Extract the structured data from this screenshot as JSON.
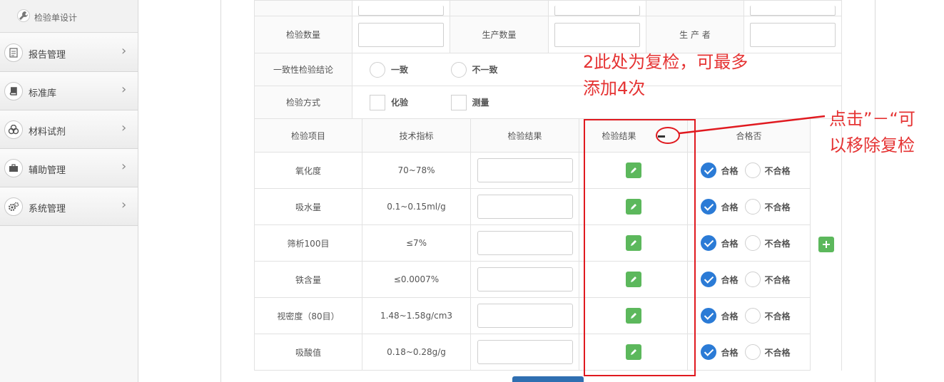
{
  "sidebar": {
    "sub_item": "检验单设计",
    "items": [
      {
        "label": "报告管理",
        "icon": "document-icon"
      },
      {
        "label": "标准库",
        "icon": "book-icon"
      },
      {
        "label": "材料试剂",
        "icon": "flask-icon"
      },
      {
        "label": "辅助管理",
        "icon": "briefcase-icon"
      },
      {
        "label": "系统管理",
        "icon": "gears-icon"
      }
    ]
  },
  "form": {
    "quantity_label": "检验数量",
    "production_qty_label": "生产数量",
    "producer_label": "生 产 者",
    "consistency_label": "一致性检验结论",
    "consistency_options": [
      "一致",
      "不一致"
    ],
    "method_label": "检验方式",
    "method_options": [
      "化验",
      "测量"
    ]
  },
  "table": {
    "headers": [
      "检验项目",
      "技术指标",
      "检验结果",
      "检验结果",
      "合格否"
    ],
    "pass_label": "合格",
    "fail_label": "不合格",
    "rows": [
      {
        "item": "氧化度",
        "spec": "70~78%"
      },
      {
        "item": "吸水量",
        "spec": "0.1~0.15ml/g"
      },
      {
        "item": "筛析100目",
        "spec": "≤7%"
      },
      {
        "item": "铁含量",
        "spec": "≤0.0007%"
      },
      {
        "item": "视密度（80目）",
        "spec": "1.48~1.58g/cm3"
      },
      {
        "item": "吸酸值",
        "spec": "0.18~0.28g/g"
      }
    ]
  },
  "annotations": {
    "note1_line1": "2此处为复检，可最多",
    "note1_line2": "添加4次",
    "note2_line1": "点击”－“可",
    "note2_line2": "以移除复检"
  },
  "colors": {
    "accent_green": "#5cb85c",
    "accent_blue": "#2b7bd6",
    "annotation_red": "#e0191f"
  }
}
